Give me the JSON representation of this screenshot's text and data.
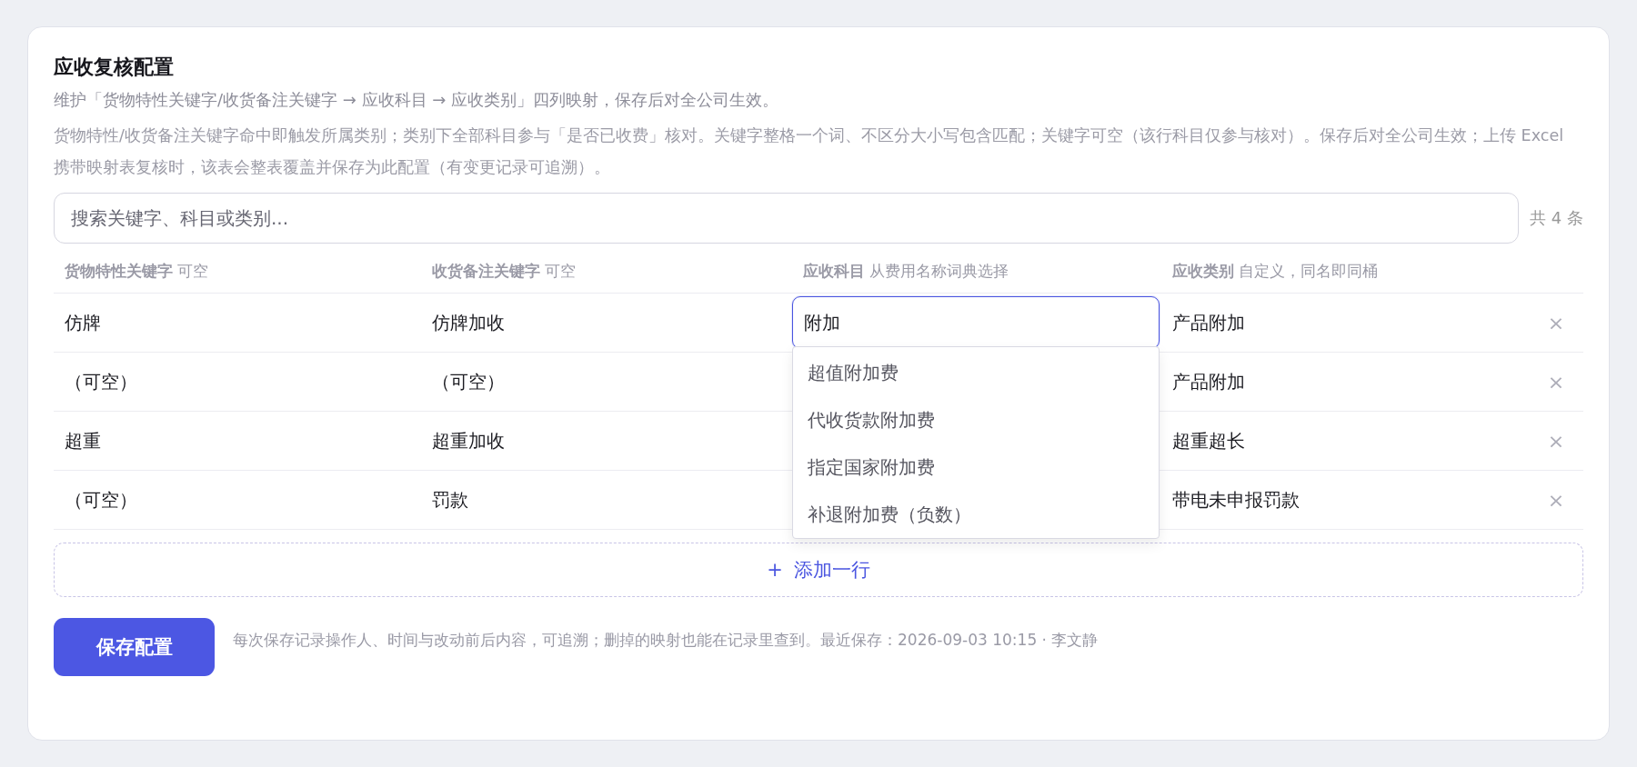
{
  "title": "应收复核配置",
  "subtitle": "维护「货物特性关键字/收货备注关键字 → 应收科目 → 应收类别」四列映射，保存后对全公司生效。",
  "description": "货物特性/收货备注关键字命中即触发所属类别；类别下全部科目参与「是否已收费」核对。关键字整格一个词、不区分大小写包含匹配；关键字可空（该行科目仅参与核对）。保存后对全公司生效；上传 Excel 携带映射表复核时，该表会整表覆盖并保存为此配置（有变更记录可追溯）。",
  "search": {
    "placeholder": "搜索关键字、科目或类别..."
  },
  "count": "共 4 条",
  "columns": [
    {
      "name": "货物特性关键字",
      "hint": "可空"
    },
    {
      "name": "收货备注关键字",
      "hint": "可空"
    },
    {
      "name": "应收科目",
      "hint": "从费用名称词典选择"
    },
    {
      "name": "应收类别",
      "hint": "自定义，同名即同桶"
    }
  ],
  "rows": [
    {
      "keyword": "仿牌",
      "remark": "仿牌加收",
      "subject": {
        "value": "附加",
        "focused": true
      },
      "category": "产品附加",
      "delete": "×"
    },
    {
      "keyword": "（可空）",
      "remark": "（可空）",
      "category": "产品附加",
      "delete": "×"
    },
    {
      "keyword": "超重",
      "remark": "超重加收",
      "category": "超重超长",
      "delete": "×"
    },
    {
      "keyword": "（可空）",
      "remark": "罚款",
      "category": "带电未申报罚款",
      "delete": "×"
    }
  ],
  "dropdown": {
    "items": [
      "超值附加费",
      "代收货款附加费",
      "指定国家附加费",
      "补退附加费（负数）"
    ]
  },
  "add_row": {
    "icon": "+",
    "label": "添加一行"
  },
  "save_button": "保存配置",
  "footnote": "每次保存记录操作人、时间与改动前后内容，可追溯；删掉的映射也能在记录里查到。最近保存：2026-09-03 10:15 · 李文静"
}
